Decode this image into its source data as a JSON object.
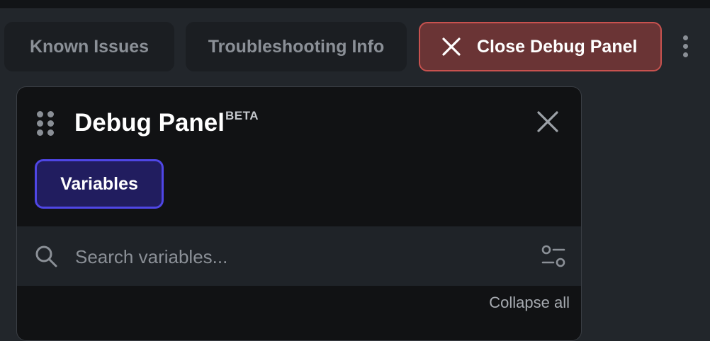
{
  "toolbar": {
    "known_issues_label": "Known Issues",
    "troubleshooting_label": "Troubleshooting Info",
    "close_debug_label": "Close Debug Panel",
    "close_debug_icon": "close-icon",
    "more_icon": "kebab-menu-icon"
  },
  "debug_panel": {
    "title": "Debug Panel",
    "badge": "BETA",
    "drag_icon": "drag-handle-icon",
    "close_icon": "close-icon",
    "tabs": [
      {
        "label": "Variables",
        "active": true
      }
    ],
    "search": {
      "placeholder": "Search variables...",
      "value": "",
      "icon": "search-icon",
      "filter_icon": "filter-settings-icon"
    },
    "collapse_all_label": "Collapse all"
  },
  "colors": {
    "background": "#22262b",
    "panel_background": "#111214",
    "accent": "#4f46e5",
    "active_tab_background": "#211d5f",
    "danger": "#c8524f",
    "danger_background": "#6a3435",
    "muted_text": "#8b9097"
  }
}
